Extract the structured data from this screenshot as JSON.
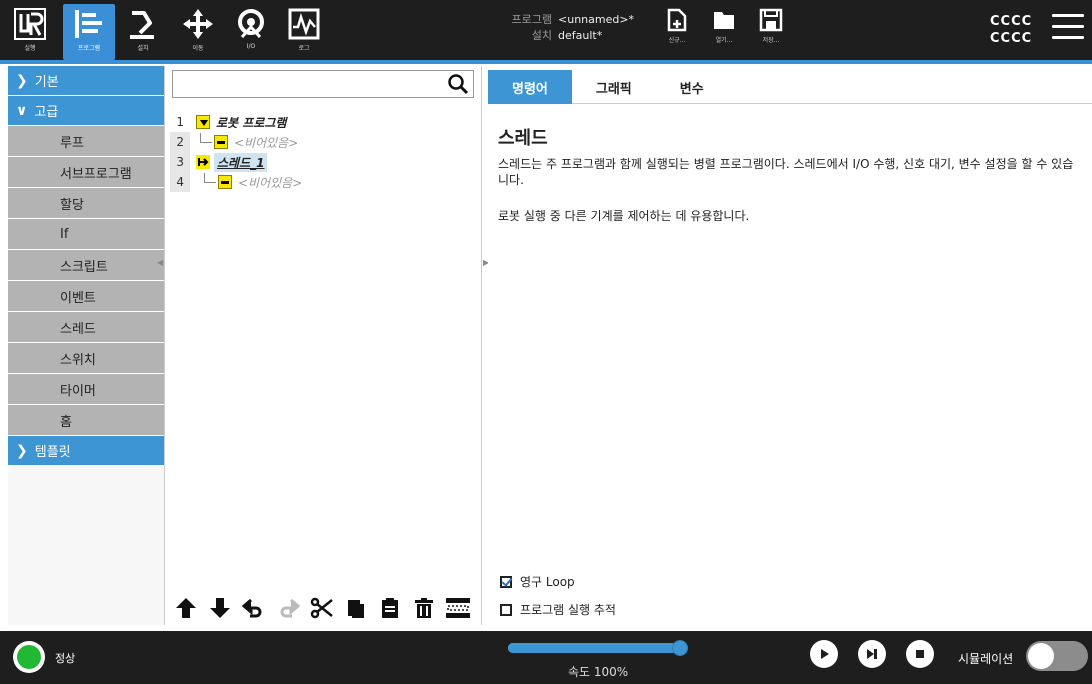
{
  "topbar": {
    "nav": [
      {
        "label": "실행",
        "icon": "ur-logo-icon"
      },
      {
        "label": "프로그램",
        "icon": "program-tree-icon",
        "active": true
      },
      {
        "label": "설치",
        "icon": "installation-robot-icon"
      },
      {
        "label": "이동",
        "icon": "move-arrows-icon"
      },
      {
        "label": "I/O",
        "icon": "io-icon"
      },
      {
        "label": "로그",
        "icon": "log-waveform-icon"
      }
    ],
    "program_key": "프로그램",
    "program_value": "<unnamed>*",
    "install_key": "설치",
    "install_value": "default*",
    "file_buttons": [
      {
        "label": "신규...",
        "icon": "new-file-icon"
      },
      {
        "label": "열기...",
        "icon": "open-folder-icon"
      },
      {
        "label": "저장...",
        "icon": "save-disk-icon"
      }
    ],
    "user_line1": "CCCC",
    "user_line2": "CCCC"
  },
  "left_panel": {
    "basic_label": "기본",
    "advanced_label": "고급",
    "advanced_items": [
      "루프",
      "서브프로그램",
      "할당",
      "If",
      "스크립트",
      "이벤트",
      "스레드",
      "스위치",
      "타이머",
      "홈"
    ],
    "templates_label": "템플릿"
  },
  "tree": {
    "search_value": "",
    "rows": [
      {
        "num": "1",
        "text": "로봇 프로그램"
      },
      {
        "num": "2",
        "text": "<비어있음>"
      },
      {
        "num": "3",
        "text": "스레드_1"
      },
      {
        "num": "4",
        "text": "<비어있음>"
      }
    ]
  },
  "right_panel": {
    "tabs": [
      "명령어",
      "그래픽",
      "변수"
    ],
    "title": "스레드",
    "description": "스레드는 주 프로그램과 함께 실행되는 병렬 프로그램이다. 스레드에서 I/O 수행, 신호 대기, 변수 설정을 할 수 있습니다.",
    "note": "로봇 실행 중 다른 기계를 제어하는 데 유용합니다.",
    "loop_forever_label": "영구 Loop",
    "loop_forever_checked": true,
    "trace_label": "프로그램 실행 추적",
    "trace_checked": false
  },
  "bottombar": {
    "status_label": "정상",
    "status_color": "#21b833",
    "speed_label": "속도 100%",
    "speed_fraction": 1.0,
    "sim_label": "시뮬레이션",
    "sim_on": false
  },
  "colors": {
    "accent": "#3d95d3",
    "topbar_bg": "#1e1e1e",
    "node_yellow": "#f6e800"
  }
}
